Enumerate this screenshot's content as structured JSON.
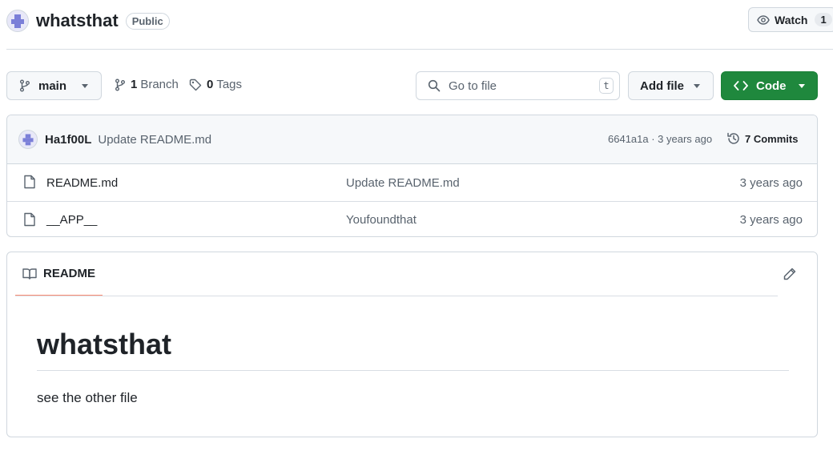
{
  "repo": {
    "name": "whatsthat",
    "visibility": "Public"
  },
  "watch": {
    "label": "Watch",
    "count": "1"
  },
  "toolbar": {
    "branch_label": "main",
    "branches_count": "1",
    "branches_label": "Branch",
    "tags_count": "0",
    "tags_label": "Tags",
    "search_placeholder": "Go to file",
    "search_shortcut": "t",
    "add_file_label": "Add file",
    "code_label": "Code"
  },
  "latest_commit": {
    "author": "Ha1f00L",
    "message": "Update README.md",
    "meta": "6641a1a · 3 years ago",
    "commits_label": "7 Commits"
  },
  "files": [
    {
      "name": "README.md",
      "commit": "Update README.md",
      "date": "3 years ago",
      "icon": "file-icon"
    },
    {
      "name": "__APP__",
      "commit": "Youfoundthat",
      "date": "3 years ago",
      "icon": "file-icon"
    }
  ],
  "readme": {
    "tab_label": "README",
    "title": "whatsthat",
    "body": "see the other file"
  },
  "colors": {
    "primary_button": "#1f883d",
    "tab_underline": "#fd8c73",
    "border": "#d0d7de",
    "muted_text": "#59636e"
  }
}
